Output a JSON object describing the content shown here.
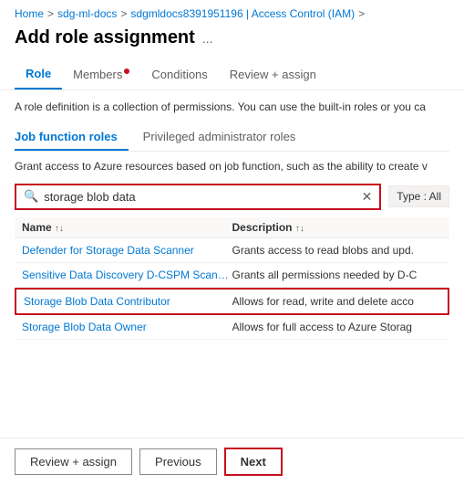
{
  "breadcrumb": {
    "items": [
      "Home",
      "sdg-ml-docs",
      "sdgmldocs8391951196 | Access Control (IAM)"
    ],
    "separator": ">"
  },
  "page_title": "Add role assignment",
  "page_title_ellipsis": "...",
  "tabs": [
    {
      "id": "role",
      "label": "Role",
      "active": true,
      "dot": false
    },
    {
      "id": "members",
      "label": "Members",
      "active": false,
      "dot": true
    },
    {
      "id": "conditions",
      "label": "Conditions",
      "active": false,
      "dot": false
    },
    {
      "id": "review_assign",
      "label": "Review + assign",
      "active": false,
      "dot": false
    }
  ],
  "description": "A role definition is a collection of permissions. You can use the built-in roles or you ca",
  "sub_tabs": [
    {
      "label": "Job function roles",
      "active": true
    },
    {
      "label": "Privileged administrator roles",
      "active": false
    }
  ],
  "sub_description": "Grant access to Azure resources based on job function, such as the ability to create v",
  "search": {
    "value": "storage blob data",
    "placeholder": "Search"
  },
  "type_badge": "Type : All",
  "table": {
    "columns": [
      {
        "label": "Name",
        "sort": "↑↓"
      },
      {
        "label": "Description",
        "sort": "↑↓"
      }
    ],
    "rows": [
      {
        "name": "Defender for Storage Data Scanner",
        "description": "Grants access to read blobs and upd.",
        "selected": false
      },
      {
        "name": "Sensitive Data Discovery D-CSPM Scanner O...",
        "description": "Grants all permissions needed by D-C",
        "selected": false
      },
      {
        "name": "Storage Blob Data Contributor",
        "description": "Allows for read, write and delete acco",
        "selected": true
      },
      {
        "name": "Storage Blob Data Owner",
        "description": "Allows for full access to Azure Storag",
        "selected": false
      }
    ]
  },
  "footer": {
    "review_assign_label": "Review + assign",
    "previous_label": "Previous",
    "next_label": "Next"
  }
}
